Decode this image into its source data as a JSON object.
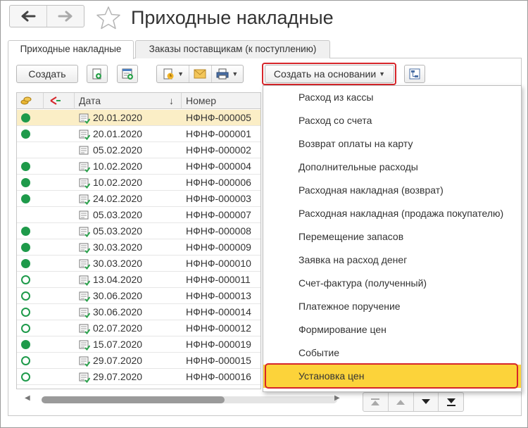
{
  "window": {
    "title": "Приходные накладные"
  },
  "tabs": [
    {
      "label": "Приходные накладные",
      "active": true
    },
    {
      "label": "Заказы поставщикам (к поступлению)",
      "active": false
    }
  ],
  "toolbar": {
    "create_label": "Создать",
    "create_based_label": "Создать на основании"
  },
  "table": {
    "headers": {
      "date": "Дата",
      "sort_indicator": "↓",
      "number": "Номер"
    },
    "rows": [
      {
        "status": "posted",
        "date": "20.01.2020",
        "number": "НФНФ-000005",
        "selected": true
      },
      {
        "status": "posted",
        "date": "20.01.2020",
        "number": "НФНФ-000001"
      },
      {
        "status": "none",
        "date": "05.02.2020",
        "number": "НФНФ-000002"
      },
      {
        "status": "posted",
        "date": "10.02.2020",
        "number": "НФНФ-000004"
      },
      {
        "status": "posted",
        "date": "10.02.2020",
        "number": "НФНФ-000006"
      },
      {
        "status": "posted",
        "date": "24.02.2020",
        "number": "НФНФ-000003"
      },
      {
        "status": "none",
        "date": "05.03.2020",
        "number": "НФНФ-000007"
      },
      {
        "status": "posted",
        "date": "05.03.2020",
        "number": "НФНФ-000008"
      },
      {
        "status": "posted",
        "date": "30.03.2020",
        "number": "НФНФ-000009"
      },
      {
        "status": "posted",
        "date": "30.03.2020",
        "number": "НФНФ-000010"
      },
      {
        "status": "open",
        "date": "13.04.2020",
        "number": "НФНФ-000011"
      },
      {
        "status": "open",
        "date": "30.06.2020",
        "number": "НФНФ-000013"
      },
      {
        "status": "open",
        "date": "30.06.2020",
        "number": "НФНФ-000014"
      },
      {
        "status": "open",
        "date": "02.07.2020",
        "number": "НФНФ-000012"
      },
      {
        "status": "posted",
        "date": "15.07.2020",
        "number": "НФНФ-000019"
      },
      {
        "status": "open",
        "date": "29.07.2020",
        "number": "НФНФ-000015"
      },
      {
        "status": "open",
        "date": "29.07.2020",
        "number": "НФНФ-000016"
      }
    ]
  },
  "menu": {
    "items": [
      "Расход из кассы",
      "Расход со счета",
      "Возврат оплаты на карту",
      "Дополнительные расходы",
      "Расходная накладная (возврат)",
      "Расходная накладная (продажа покупателю)",
      "Перемещение запасов",
      "Заявка на расход денег",
      "Счет-фактура (полученный)",
      "Платежное поручение",
      "Формирование цен",
      "Событие",
      "Установка цен"
    ],
    "highlighted_index": 12
  },
  "colors": {
    "status_green": "#1e9a4a",
    "selected_row": "#fbeec6",
    "menu_highlight": "#fcd33a",
    "annotation_red": "#d6252a"
  },
  "icons": {
    "back": "arrow-left-icon",
    "forward": "arrow-right-icon",
    "favorite": "star-icon",
    "copy": "copy-document-icon",
    "add_list": "add-list-icon",
    "report": "report-icon",
    "mail": "mail-icon",
    "print": "printer-icon",
    "structure": "document-structure-icon"
  }
}
